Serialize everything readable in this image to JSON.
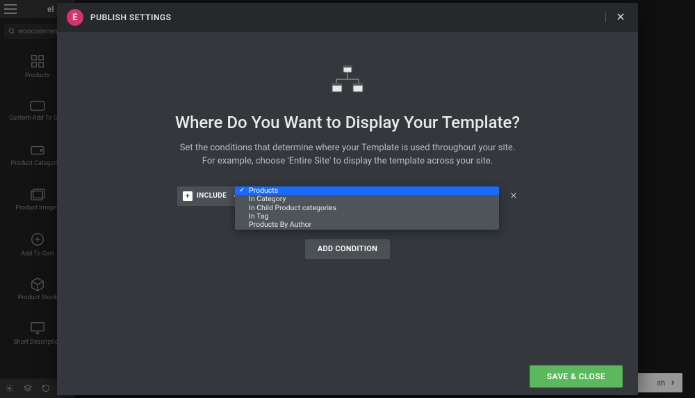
{
  "sidebar": {
    "brand": "el",
    "search_placeholder": "woocommerce",
    "items": [
      {
        "label": "Products"
      },
      {
        "label": "Custom Add To Ca..."
      },
      {
        "label": "Product Categories"
      },
      {
        "label": "Product Images"
      },
      {
        "label": "Add To Cart"
      },
      {
        "label": "Product Stock"
      },
      {
        "label": "Short Description"
      }
    ]
  },
  "modal": {
    "header_title": "PUBLISH SETTINGS",
    "heading": "Where Do You Want to Display Your Template?",
    "description_line1": "Set the conditions that determine where your Template is used throughout your site.",
    "description_line2": "For example, choose 'Entire Site' to display the template across your site.",
    "include_label": "INCLUDE",
    "dropdown_options": [
      "Products",
      "In Category",
      "In Child Product categories",
      "In Tag",
      "Products By Author"
    ],
    "add_condition_label": "ADD CONDITION",
    "save_label": "SAVE & CLOSE"
  },
  "background_chip": {
    "label": "sh"
  }
}
